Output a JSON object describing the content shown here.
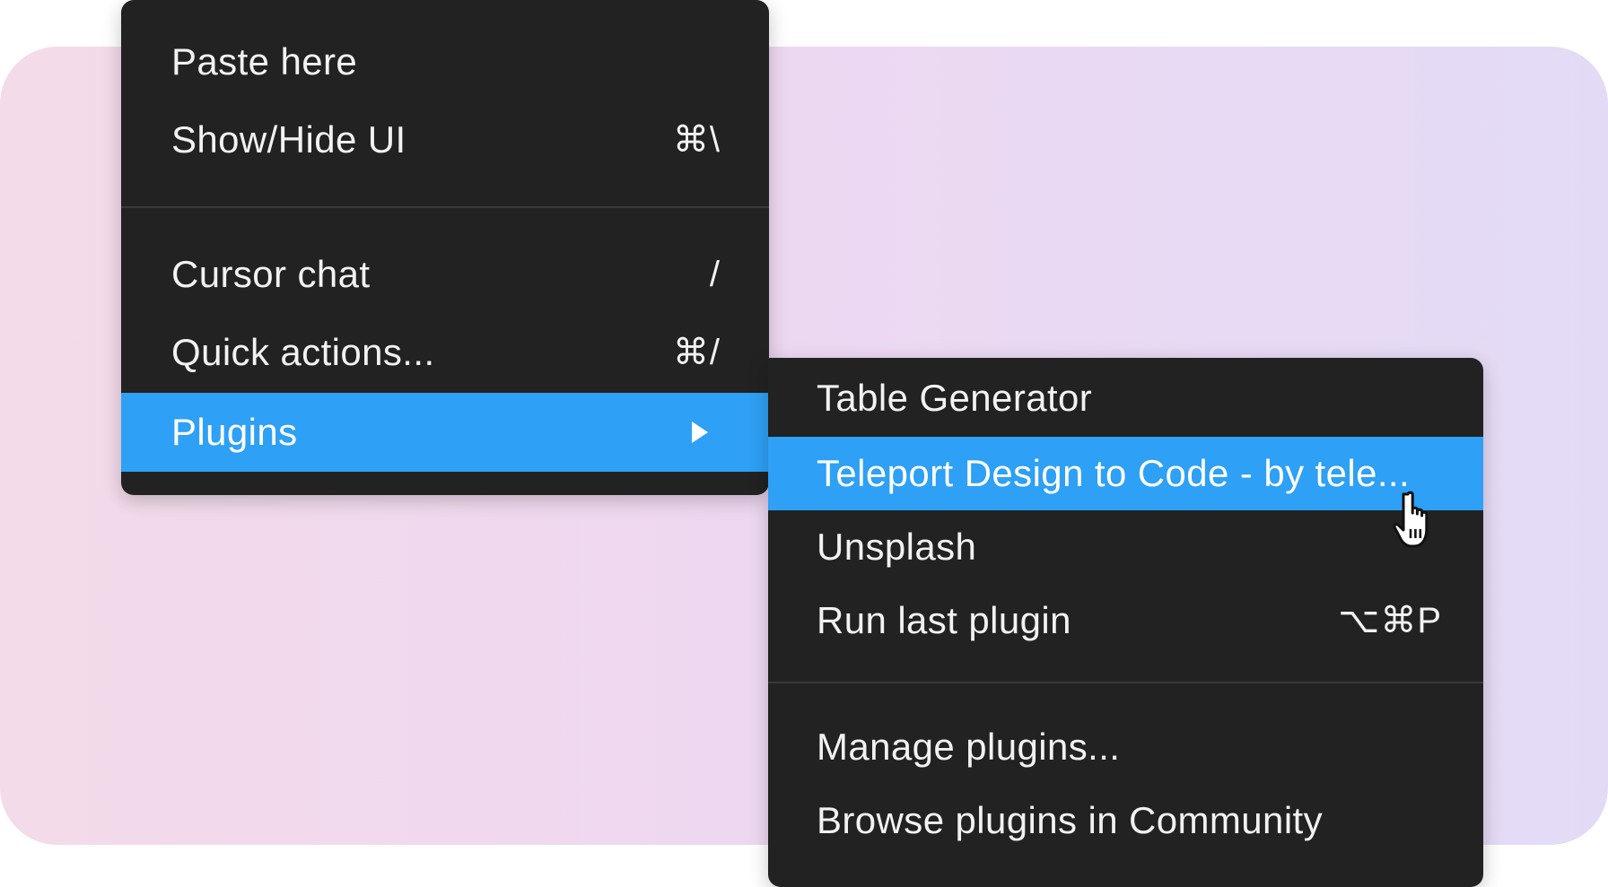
{
  "main_menu": {
    "items": [
      {
        "label": "Paste here",
        "shortcut": ""
      },
      {
        "label": "Show/Hide UI",
        "shortcut": "⌘\\"
      },
      {
        "label": "Cursor chat",
        "shortcut": "/"
      },
      {
        "label": "Quick actions...",
        "shortcut": "⌘/"
      },
      {
        "label": "Plugins",
        "shortcut": ""
      }
    ]
  },
  "plugins_submenu": {
    "items": [
      {
        "label": "Table Generator",
        "shortcut": ""
      },
      {
        "label": "Teleport Design to Code - by tele...",
        "shortcut": ""
      },
      {
        "label": "Unsplash",
        "shortcut": ""
      },
      {
        "label": "Run last plugin",
        "shortcut": "⌥⌘P"
      },
      {
        "label": "Manage plugins...",
        "shortcut": ""
      },
      {
        "label": "Browse plugins in Community",
        "shortcut": ""
      }
    ]
  },
  "colors": {
    "menu_background": "#222222",
    "highlight": "#2ea0f5",
    "text": "#f2f2f2"
  },
  "icons": {
    "submenu_arrow": "triangle-right-icon",
    "pointer": "hand-pointer-icon"
  }
}
